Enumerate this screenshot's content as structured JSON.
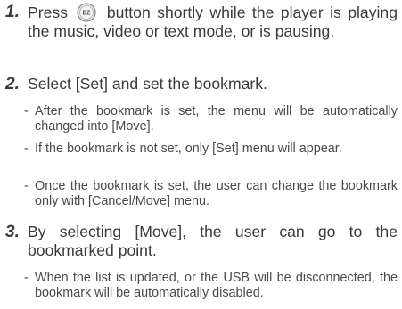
{
  "steps": [
    {
      "number": "1.",
      "text_before_icon": "Press",
      "icon": "ez-button-icon",
      "icon_label": "EZ",
      "text_after_icon": "button shortly while the player is playing the music, video or text mode, or is pausing."
    },
    {
      "number": "2.",
      "text": "Select [Set] and set the bookmark.",
      "bullets": [
        "After the bookmark is set, the menu will be automatically changed into [Move].",
        "If the bookmark is not set, only [Set] menu will appear.",
        "Once the bookmark is set, the user can change the bookmark only with [Cancel/Move] menu."
      ]
    },
    {
      "number": "3.",
      "text": "By selecting [Move], the user can go to the bookmarked point.",
      "bullets": [
        "When the list is updated, or the USB will be disconnected, the bookmark will be automatically disabled."
      ]
    }
  ],
  "dash": "-",
  "colors": {
    "text": "#3a3a3a",
    "bullet_text": "#4a4a4a",
    "icon_fill": "#e6e6e6",
    "icon_stroke": "#888888"
  }
}
